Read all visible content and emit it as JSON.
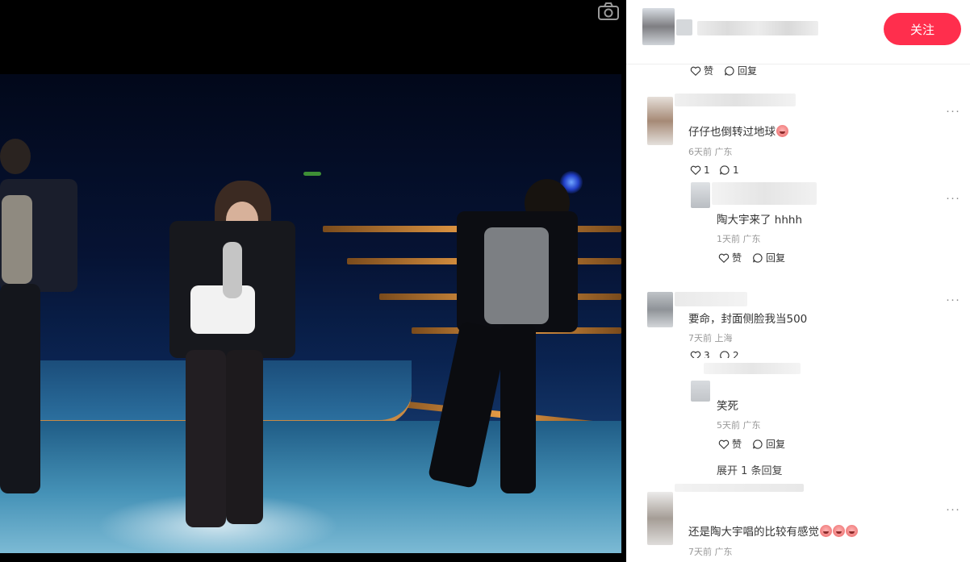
{
  "header": {
    "follow_label": "关注"
  },
  "comments": [
    {
      "id": "c0",
      "partial": true,
      "like_label": "赞",
      "reply_label": "回复"
    },
    {
      "id": "c1",
      "text": "仔仔也倒转过地球",
      "emoji_count": 1,
      "time": "6天前",
      "location": "广东",
      "likes": "1",
      "replies": "1"
    },
    {
      "id": "c1r1",
      "text": "陶大宇来了 hhhh",
      "time": "1天前",
      "location": "广东",
      "like_label": "赞",
      "reply_label": "回复"
    },
    {
      "id": "c2",
      "text": "要命，封面侧脸我当500",
      "time": "7天前",
      "location": "上海",
      "likes": "3",
      "replies": "2"
    },
    {
      "id": "c2r1",
      "text": "笑死",
      "time": "5天前",
      "location": "广东",
      "like_label": "赞",
      "reply_label": "回复"
    },
    {
      "id": "c2expand",
      "expand_label": "展开 1 条回复"
    },
    {
      "id": "c3",
      "text": "还是陶大宇唱的比较有感觉",
      "emoji_count": 3,
      "time": "7天前",
      "location": "广东"
    }
  ],
  "icons": {
    "camera": "camera-icon",
    "like": "heart-outline-icon",
    "reply": "chat-bubble-icon",
    "more": "more-dots-icon"
  },
  "colors": {
    "accent": "#ff2e4d",
    "text": "#333333",
    "meta": "#999999"
  }
}
